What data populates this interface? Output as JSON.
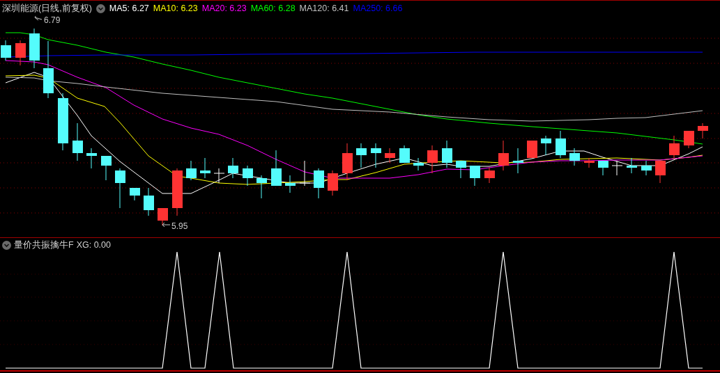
{
  "main_panel": {
    "title": "深圳能源(日线,前复权)",
    "ma_legend": [
      {
        "label": "MA5: 6.27",
        "color": "#ffffff"
      },
      {
        "label": "MA10: 6.23",
        "color": "#ffff00"
      },
      {
        "label": "MA20: 6.23",
        "color": "#ff00ff"
      },
      {
        "label": "MA60: 6.28",
        "color": "#00ff00"
      },
      {
        "label": "MA120: 6.41",
        "color": "#c0c0c0"
      },
      {
        "label": "MA250: 6.66",
        "color": "#0000ff"
      }
    ],
    "high_label": "6.79",
    "low_label": "5.95"
  },
  "indicator_panel": {
    "title": "量价共振擒牛F",
    "value": "XG: 0.00"
  }
}
